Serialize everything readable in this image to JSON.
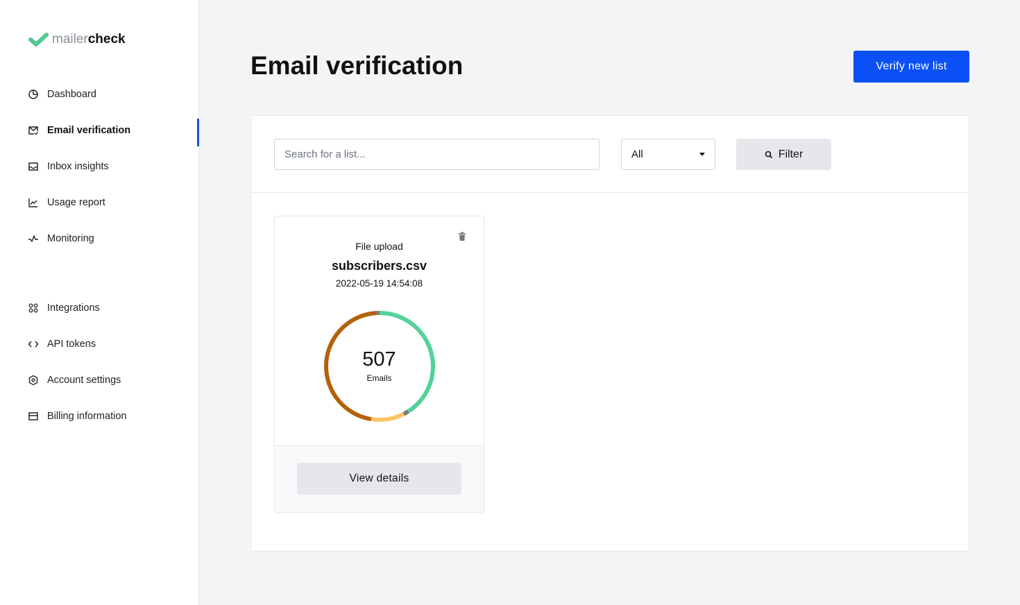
{
  "logo": {
    "part1": "mailer",
    "part2": "check"
  },
  "sidebar": {
    "items": [
      {
        "label": "Dashboard",
        "icon": "pie-chart-icon"
      },
      {
        "label": "Email verification",
        "icon": "mail-check-icon",
        "active": true
      },
      {
        "label": "Inbox insights",
        "icon": "inbox-icon"
      },
      {
        "label": "Usage report",
        "icon": "line-chart-icon"
      },
      {
        "label": "Monitoring",
        "icon": "activity-icon"
      },
      {
        "label": "Integrations",
        "icon": "grid-icon"
      },
      {
        "label": "API tokens",
        "icon": "code-icon"
      },
      {
        "label": "Account settings",
        "icon": "gear-icon"
      },
      {
        "label": "Billing information",
        "icon": "credit-card-icon"
      }
    ]
  },
  "header": {
    "title": "Email verification",
    "verify_button": "Verify new list"
  },
  "toolbar": {
    "search_placeholder": "Search for a list...",
    "select_value": "All",
    "filter_label": "Filter"
  },
  "card": {
    "type": "File upload",
    "filename": "subscribers.csv",
    "date": "2022-05-19 14:54:08",
    "count": "507",
    "count_label": "Emails",
    "view_button": "View details",
    "segments": [
      {
        "fraction": 0.41,
        "color": "#52d199"
      },
      {
        "fraction": 0.015,
        "color": "#7a7a7a"
      },
      {
        "fraction": 0.1,
        "color": "#fcc466"
      },
      {
        "fraction": 0.465,
        "color": "#b4620a"
      },
      {
        "fraction": 0.01,
        "color": "#7a7a7a"
      }
    ]
  },
  "colors": {
    "accent": "#0b50f4"
  }
}
